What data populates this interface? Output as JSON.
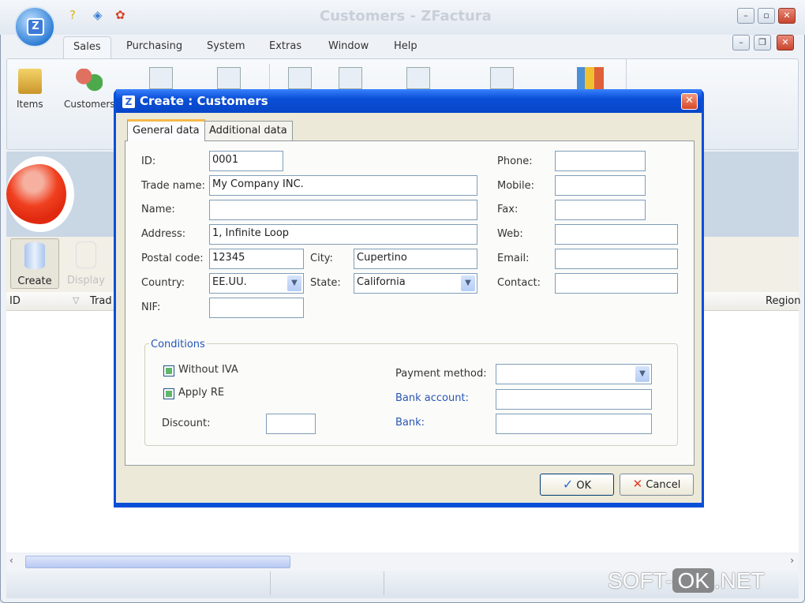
{
  "app": {
    "title": "Customers - ZFactura",
    "logo_letter": "Z"
  },
  "quick_access": [
    {
      "icon": "help-icon"
    },
    {
      "icon": "navigate-icon"
    },
    {
      "icon": "award-icon"
    }
  ],
  "menu_tabs": [
    {
      "label": "Sales",
      "active": true
    },
    {
      "label": "Purchasing"
    },
    {
      "label": "System"
    },
    {
      "label": "Extras"
    },
    {
      "label": "Window"
    },
    {
      "label": "Help"
    }
  ],
  "ribbon": {
    "items": [
      {
        "label": "Items",
        "icon": "box-icon"
      },
      {
        "label": "Customers",
        "icon": "customers-icon"
      }
    ]
  },
  "toolbar": {
    "create": "Create",
    "display": "Display"
  },
  "grid": {
    "columns": [
      "ID",
      "Trad",
      "Region"
    ]
  },
  "dialog": {
    "title": "Create : Customers",
    "logo_letter": "Z",
    "tabs": [
      {
        "label": "General data",
        "active": true
      },
      {
        "label": "Additional data"
      }
    ],
    "fields": {
      "id": {
        "label": "ID:",
        "value": "0001"
      },
      "trade_name": {
        "label": "Trade name:",
        "value": "My Company INC."
      },
      "name": {
        "label": "Name:",
        "value": ""
      },
      "address": {
        "label": "Address:",
        "value": "1, Infinite Loop"
      },
      "postal_code": {
        "label": "Postal code:",
        "value": "12345"
      },
      "city": {
        "label": "City:",
        "value": "Cupertino"
      },
      "country": {
        "label": "Country:",
        "value": "EE.UU."
      },
      "state": {
        "label": "State:",
        "value": "California"
      },
      "nif": {
        "label": "NIF:",
        "value": ""
      },
      "phone": {
        "label": "Phone:",
        "value": ""
      },
      "mobile": {
        "label": "Mobile:",
        "value": ""
      },
      "fax": {
        "label": "Fax:",
        "value": ""
      },
      "web": {
        "label": "Web:",
        "value": ""
      },
      "email": {
        "label": "Email:",
        "value": ""
      },
      "contact": {
        "label": "Contact:",
        "value": ""
      }
    },
    "conditions": {
      "title": "Conditions",
      "without_iva": {
        "label": "Without IVA",
        "checked": true
      },
      "apply_re": {
        "label": "Apply RE",
        "checked": true
      },
      "discount": {
        "label": "Discount:",
        "value": ""
      },
      "payment_method": {
        "label": "Payment method:",
        "value": ""
      },
      "bank_account": {
        "label": "Bank account:",
        "value": ""
      },
      "bank": {
        "label": "Bank:",
        "value": ""
      }
    },
    "ok": "OK",
    "cancel": "Cancel"
  },
  "watermark": {
    "left": "SOFT-",
    "mid": "OK",
    "right": ".NET"
  }
}
